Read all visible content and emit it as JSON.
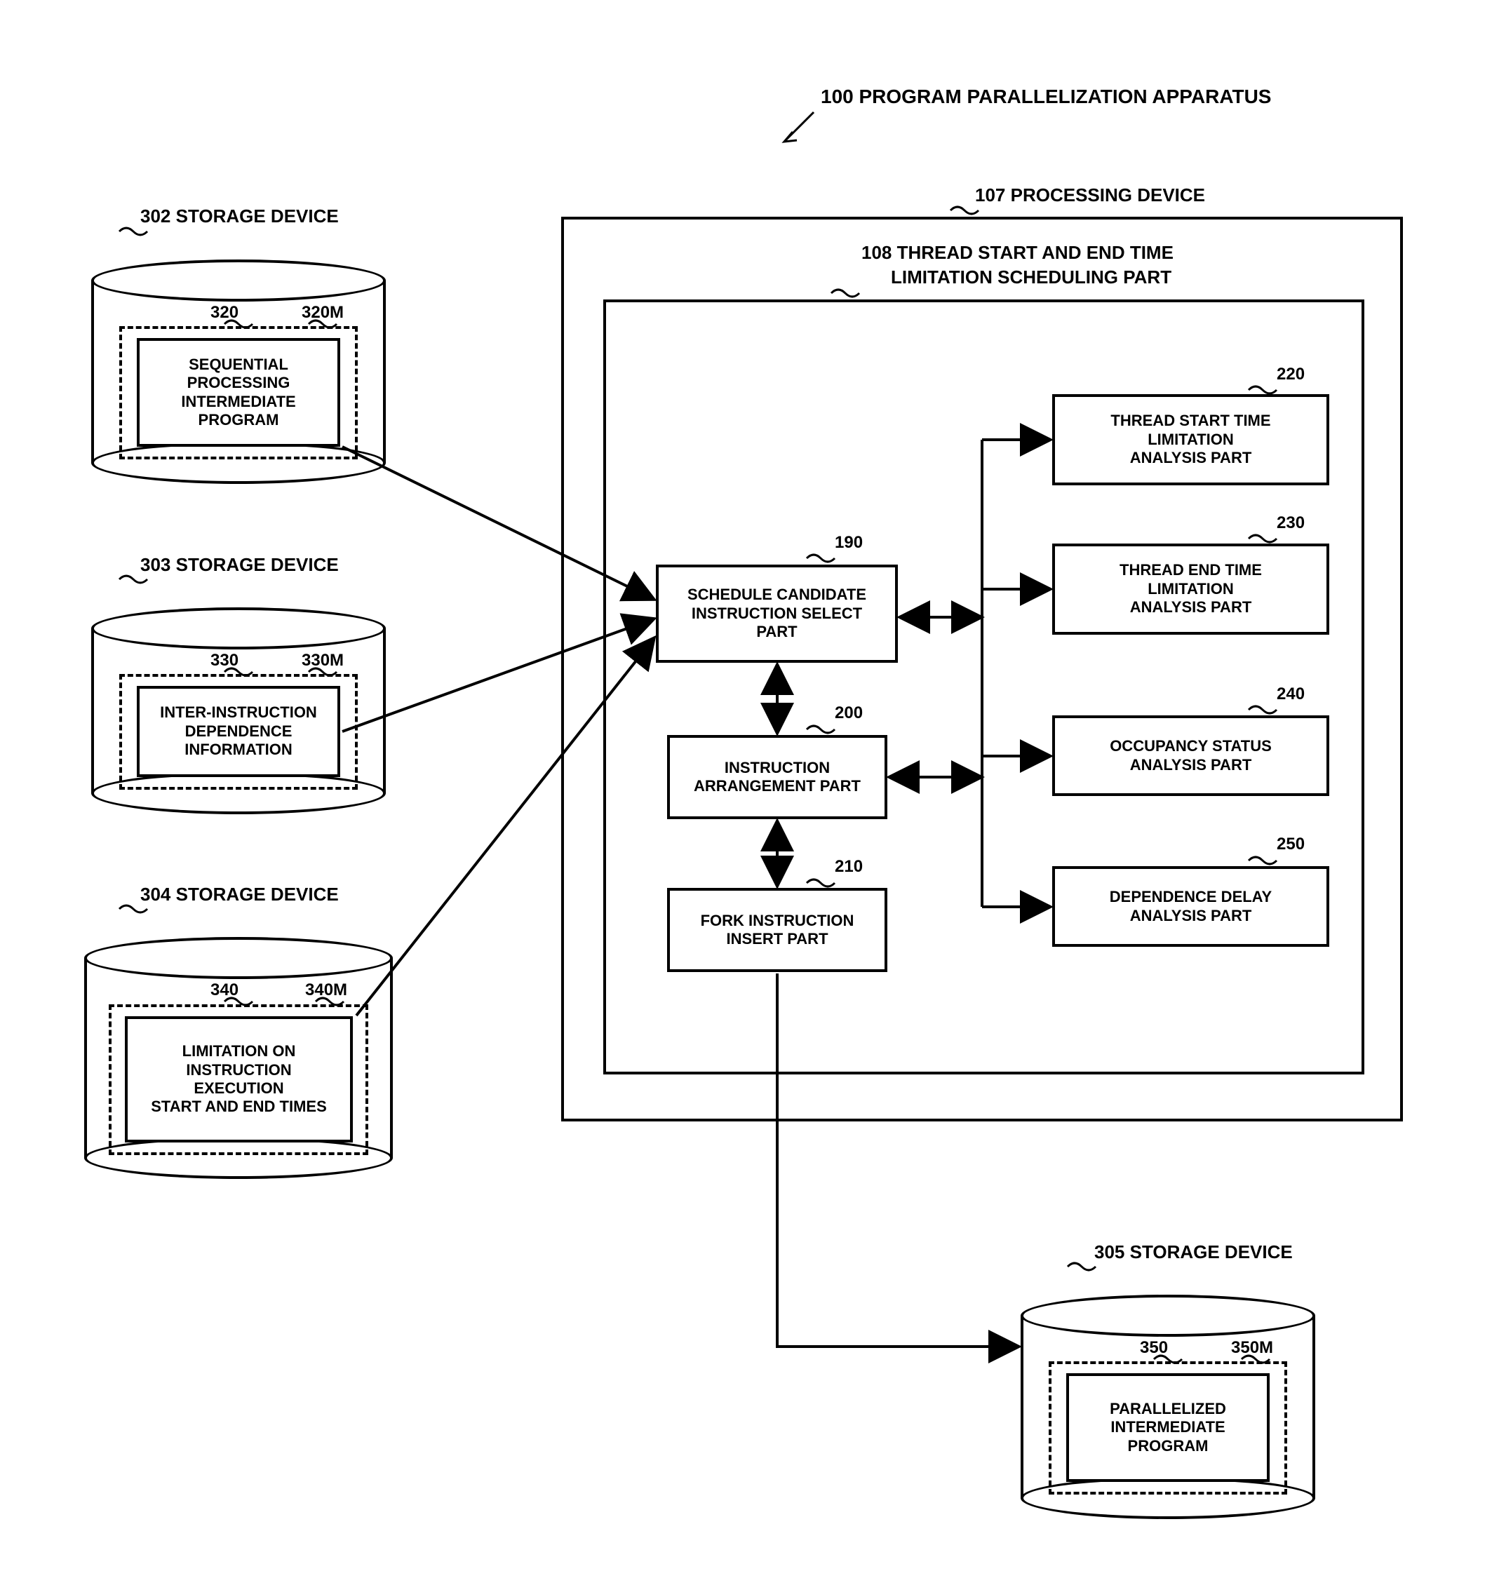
{
  "title_100": "100  PROGRAM PARALLELIZATION APPARATUS",
  "title_107": "107  PROCESSING DEVICE",
  "title_108_a": "108 THREAD START AND END TIME",
  "title_108_b": "LIMITATION SCHEDULING PART",
  "dev302_label": "302  STORAGE DEVICE",
  "dev302_ref320": "320",
  "dev302_ref320M": "320M",
  "dev302_inner": "SEQUENTIAL\nPROCESSING\nINTERMEDIATE\nPROGRAM",
  "dev303_label": "303  STORAGE DEVICE",
  "dev303_ref330": "330",
  "dev303_ref330M": "330M",
  "dev303_inner": "INTER-INSTRUCTION\nDEPENDENCE\nINFORMATION",
  "dev304_label": "304  STORAGE DEVICE",
  "dev304_ref340": "340",
  "dev304_ref340M": "340M",
  "dev304_inner": "LIMITATION ON\nINSTRUCTION\nEXECUTION\nSTART AND END TIMES",
  "dev305_label": "305  STORAGE DEVICE",
  "dev305_ref350": "350",
  "dev305_ref350M": "350M",
  "dev305_inner": "PARALLELIZED\nINTERMEDIATE\nPROGRAM",
  "box190_ref": "190",
  "box190": "SCHEDULE CANDIDATE\nINSTRUCTION SELECT\nPART",
  "box200_ref": "200",
  "box200": "INSTRUCTION\nARRANGEMENT PART",
  "box210_ref": "210",
  "box210": "FORK INSTRUCTION\nINSERT PART",
  "box220_ref": "220",
  "box220": "THREAD START TIME\nLIMITATION\nANALYSIS PART",
  "box230_ref": "230",
  "box230": "THREAD END TIME\nLIMITATION\nANALYSIS PART",
  "box240_ref": "240",
  "box240": "OCCUPANCY STATUS\nANALYSIS PART",
  "box250_ref": "250",
  "box250": "DEPENDENCE DELAY\nANALYSIS PART"
}
